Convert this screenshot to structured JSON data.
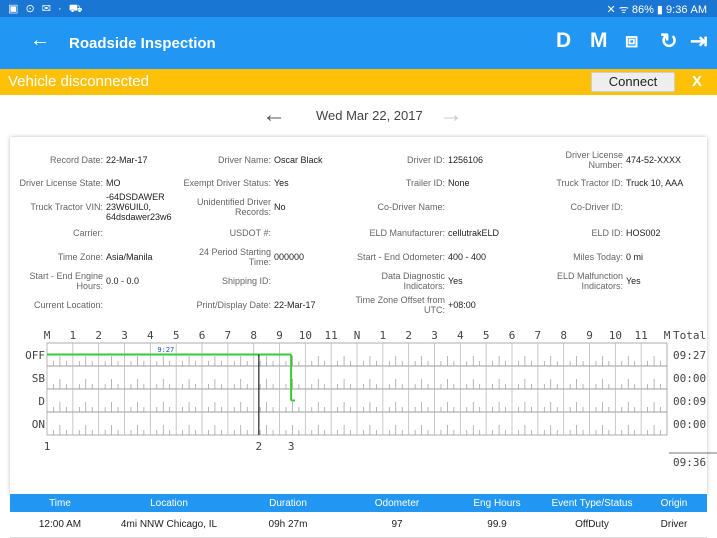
{
  "status_bar": {
    "left_icons": "▣ ⊙ ✉ · ⛟",
    "right": "✕ ᯤ 86% ▮ 9:36 AM"
  },
  "app_bar": {
    "title": "Roadside Inspection",
    "actions": [
      "D",
      "M",
      "⧈",
      "↻",
      "⇥"
    ]
  },
  "banner": {
    "message": "Vehicle disconnected",
    "connect_label": "Connect",
    "close_label": "X",
    "color": "#ffc107"
  },
  "date_nav": {
    "date": "Wed Mar 22, 2017"
  },
  "info_rows": [
    [
      {
        "label": "Record Date:",
        "value": "22-Mar-17"
      },
      {
        "label": "Driver Name:",
        "value": "Oscar Black"
      },
      {
        "label": "Driver ID:",
        "value": "1256106"
      },
      {
        "label": "Driver License Number:",
        "value": "474-52-XXXX"
      }
    ],
    [
      {
        "label": "Driver License State:",
        "value": "MO"
      },
      {
        "label": "Exempt Driver Status:",
        "value": "Yes"
      },
      {
        "label": "Trailer ID:",
        "value": "None"
      },
      {
        "label": "Truck Tractor ID:",
        "value": "Truck 10, AAA"
      }
    ],
    [
      {
        "label": "Truck Tractor VIN:",
        "value": "-64DSDAWER 23W6UIL0, 64dsdawer23w6"
      },
      {
        "label": "Unidentified Driver Records:",
        "value": "No"
      },
      {
        "label": "Co-Driver Name:",
        "value": ""
      },
      {
        "label": "Co-Driver ID:",
        "value": ""
      }
    ],
    [
      {
        "label": "Carrier:",
        "value": ""
      },
      {
        "label": "USDOT #:",
        "value": ""
      },
      {
        "label": "ELD Manufacturer:",
        "value": "cellutrakELD"
      },
      {
        "label": "ELD ID:",
        "value": "HOS002"
      }
    ],
    [
      {
        "label": "Time Zone:",
        "value": "Asia/Manila"
      },
      {
        "label": "24 Period Starting Time:",
        "value": "000000"
      },
      {
        "label": "Start - End Odometer:",
        "value": "400 - 400"
      },
      {
        "label": "Miles Today:",
        "value": "0 mi"
      }
    ],
    [
      {
        "label": "Start - End Engine Hours:",
        "value": "0.0 - 0.0"
      },
      {
        "label": "Shipping ID:",
        "value": ""
      },
      {
        "label": "Data Diagnostic Indicators:",
        "value": "Yes"
      },
      {
        "label": "ELD Malfunction Indicators:",
        "value": "Yes"
      }
    ],
    [
      {
        "label": "Current Location:",
        "value": ""
      },
      {
        "label": "Print/Display Date:",
        "value": "22-Mar-17"
      },
      {
        "label": "Time Zone Offset from UTC:",
        "value": "+08:00"
      },
      {
        "label": "",
        "value": ""
      }
    ]
  ],
  "graph": {
    "hour_labels": [
      "M",
      "1",
      "2",
      "3",
      "4",
      "5",
      "6",
      "7",
      "8",
      "9",
      "10",
      "11",
      "N",
      "1",
      "2",
      "3",
      "4",
      "5",
      "6",
      "7",
      "8",
      "9",
      "10",
      "11",
      "M"
    ],
    "total_label": "Total",
    "rows": [
      {
        "label": "OFF",
        "total": "09:27"
      },
      {
        "label": "SB",
        "total": "00:00"
      },
      {
        "label": "D",
        "total": "00:09"
      },
      {
        "label": "ON",
        "total": "00:00"
      }
    ],
    "grand_total": "09:36",
    "marker_time": "9:27",
    "bottom_markers": [
      "1",
      "2",
      "3"
    ],
    "line_color": "#33cc33",
    "segments": [
      {
        "status": "OFF",
        "start_hour": 0,
        "end_hour": 9.45
      },
      {
        "status": "D",
        "start_hour": 9.45,
        "end_hour": 9.6
      }
    ],
    "marker_hours": [
      0,
      8.2,
      9.45
    ],
    "cursor_hour": 8.2
  },
  "table": {
    "headers": [
      "Time",
      "Location",
      "Duration",
      "Odometer",
      "Eng Hours",
      "Event Type/Status",
      "Origin"
    ],
    "rows": [
      [
        "12:00 AM",
        "4mi NNW Chicago, IL",
        "09h 27m",
        "97",
        "99.9",
        "OffDuty",
        "Driver"
      ]
    ]
  }
}
